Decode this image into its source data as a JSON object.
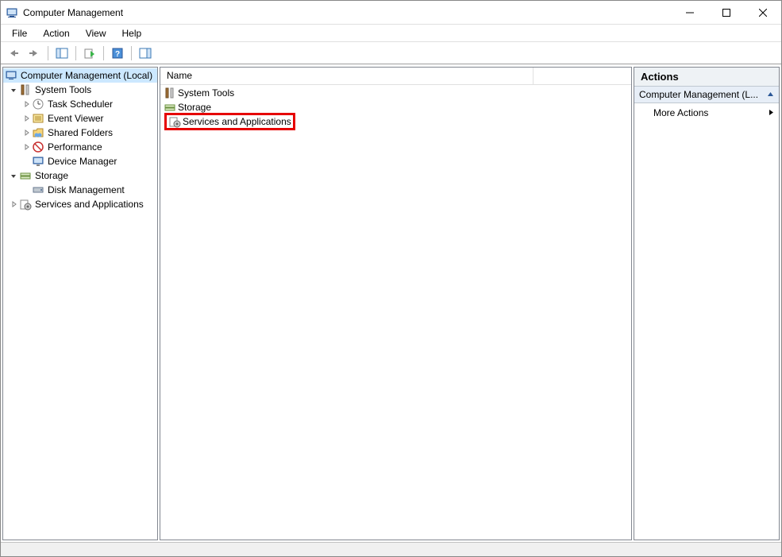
{
  "window": {
    "title": "Computer Management"
  },
  "menu": {
    "file": "File",
    "action": "Action",
    "view": "View",
    "help": "Help"
  },
  "tree": {
    "root": "Computer Management (Local)",
    "system_tools": "System Tools",
    "task_scheduler": "Task Scheduler",
    "event_viewer": "Event Viewer",
    "shared_folders": "Shared Folders",
    "performance": "Performance",
    "device_manager": "Device Manager",
    "storage": "Storage",
    "disk_management": "Disk Management",
    "services_apps": "Services and Applications"
  },
  "list": {
    "header_name": "Name",
    "item_system_tools": "System Tools",
    "item_storage": "Storage",
    "item_services_apps": "Services and Applications"
  },
  "actions": {
    "header": "Actions",
    "group": "Computer Management (L...",
    "more_actions": "More Actions"
  }
}
